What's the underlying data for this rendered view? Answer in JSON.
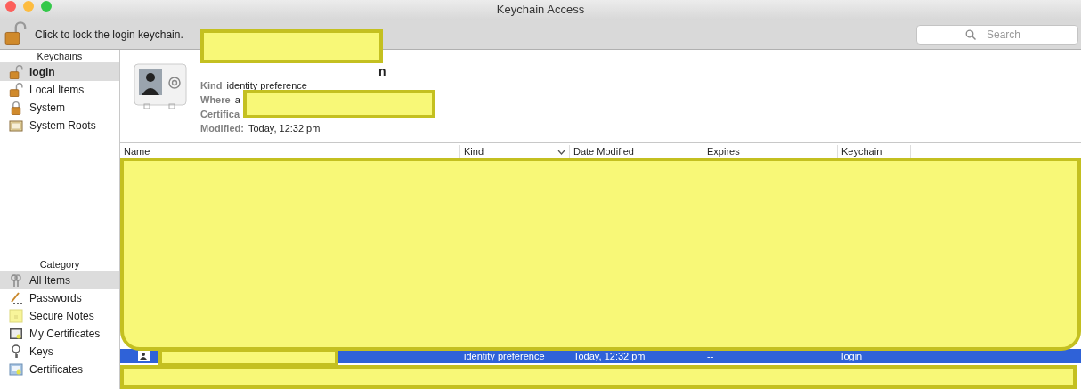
{
  "window": {
    "title": "Keychain Access"
  },
  "toolbar": {
    "lock_message": "Click to lock the login keychain.",
    "search": {
      "placeholder": "Search"
    }
  },
  "sidebar": {
    "keychains_header": "Keychains",
    "keychains": [
      {
        "label": "login",
        "kind": "unlocked",
        "selected": true
      },
      {
        "label": "Local Items",
        "kind": "unlocked",
        "selected": false
      },
      {
        "label": "System",
        "kind": "locked",
        "selected": false
      },
      {
        "label": "System Roots",
        "kind": "roots",
        "selected": false
      }
    ],
    "category_header": "Category",
    "categories": [
      {
        "label": "All Items",
        "kind": "all",
        "selected": true
      },
      {
        "label": "Passwords",
        "kind": "password",
        "selected": false
      },
      {
        "label": "Secure Notes",
        "kind": "note",
        "selected": false
      },
      {
        "label": "My Certificates",
        "kind": "mycert",
        "selected": false
      },
      {
        "label": "Keys",
        "kind": "key",
        "selected": false
      },
      {
        "label": "Certificates",
        "kind": "cert",
        "selected": false
      }
    ]
  },
  "details": {
    "title": "n",
    "fields": [
      {
        "label": "Kind",
        "value": "identity preference"
      },
      {
        "label": "Where",
        "value": "a"
      },
      {
        "label": "Certifica"
      },
      {
        "label": "Modified:",
        "value": "Today, 12:32 pm"
      }
    ]
  },
  "table": {
    "columns": [
      {
        "label": "Name",
        "sorted": false
      },
      {
        "label": "Kind",
        "sorted": true
      },
      {
        "label": "Date Modified",
        "sorted": false
      },
      {
        "label": "Expires",
        "sorted": false
      },
      {
        "label": "Keychain",
        "sorted": false
      }
    ],
    "rows": [
      {
        "selected": true,
        "cells": [
          "",
          "identity preference",
          "Today, 12:32 pm",
          "--",
          "login"
        ]
      }
    ]
  }
}
